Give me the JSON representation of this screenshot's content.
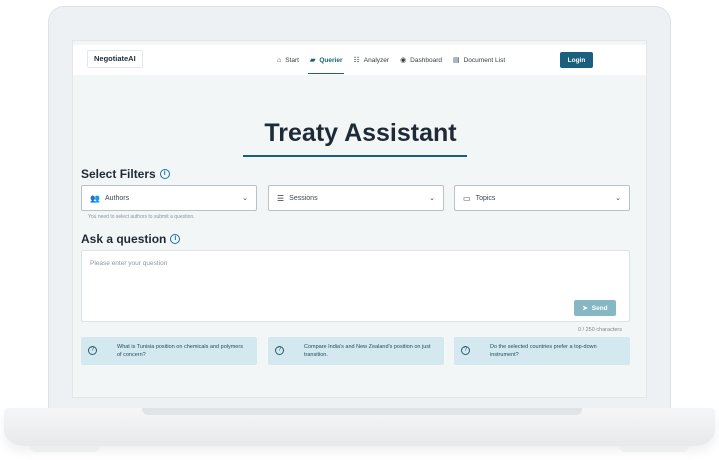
{
  "nav": {
    "brand": "NegotiateAI",
    "items": [
      {
        "icon": "home-icon",
        "glyph": "⌂",
        "label": "Start",
        "active": false
      },
      {
        "icon": "chat-icon",
        "glyph": "▰",
        "label": "Querier",
        "active": true
      },
      {
        "icon": "analyzer-icon",
        "glyph": "☷",
        "label": "Analyzer",
        "active": false
      },
      {
        "icon": "dashboard-icon",
        "glyph": "◉",
        "label": "Dashboard",
        "active": false
      },
      {
        "icon": "document-icon",
        "glyph": "▤",
        "label": "Document List",
        "active": false
      }
    ],
    "login_label": "Login"
  },
  "main": {
    "title": "Treaty Assistant",
    "filters_heading": "Select Filters",
    "filters": [
      {
        "icon": "people-icon",
        "glyph": "👥",
        "label": "Authors"
      },
      {
        "icon": "list-icon",
        "glyph": "☰",
        "label": "Sessions"
      },
      {
        "icon": "topics-icon",
        "glyph": "▭",
        "label": "Topics"
      }
    ],
    "filters_hint": "You need to select authors to submit a question.",
    "question_heading": "Ask a question",
    "question_placeholder": "Please enter your question",
    "question_value": "",
    "send_label": "Send",
    "char_counter": "0 / 250 characters",
    "suggestions": [
      "What is Tunisia position on chemicals and polymers of concern?",
      "Compare India's and New Zealand's position on just transition.",
      "Do the selected countries prefer a top-down instrument?"
    ]
  },
  "colors": {
    "accent": "#1b5f7e",
    "suggestion_bg": "#d3e8ef",
    "send_bg": "#86b7c3"
  }
}
